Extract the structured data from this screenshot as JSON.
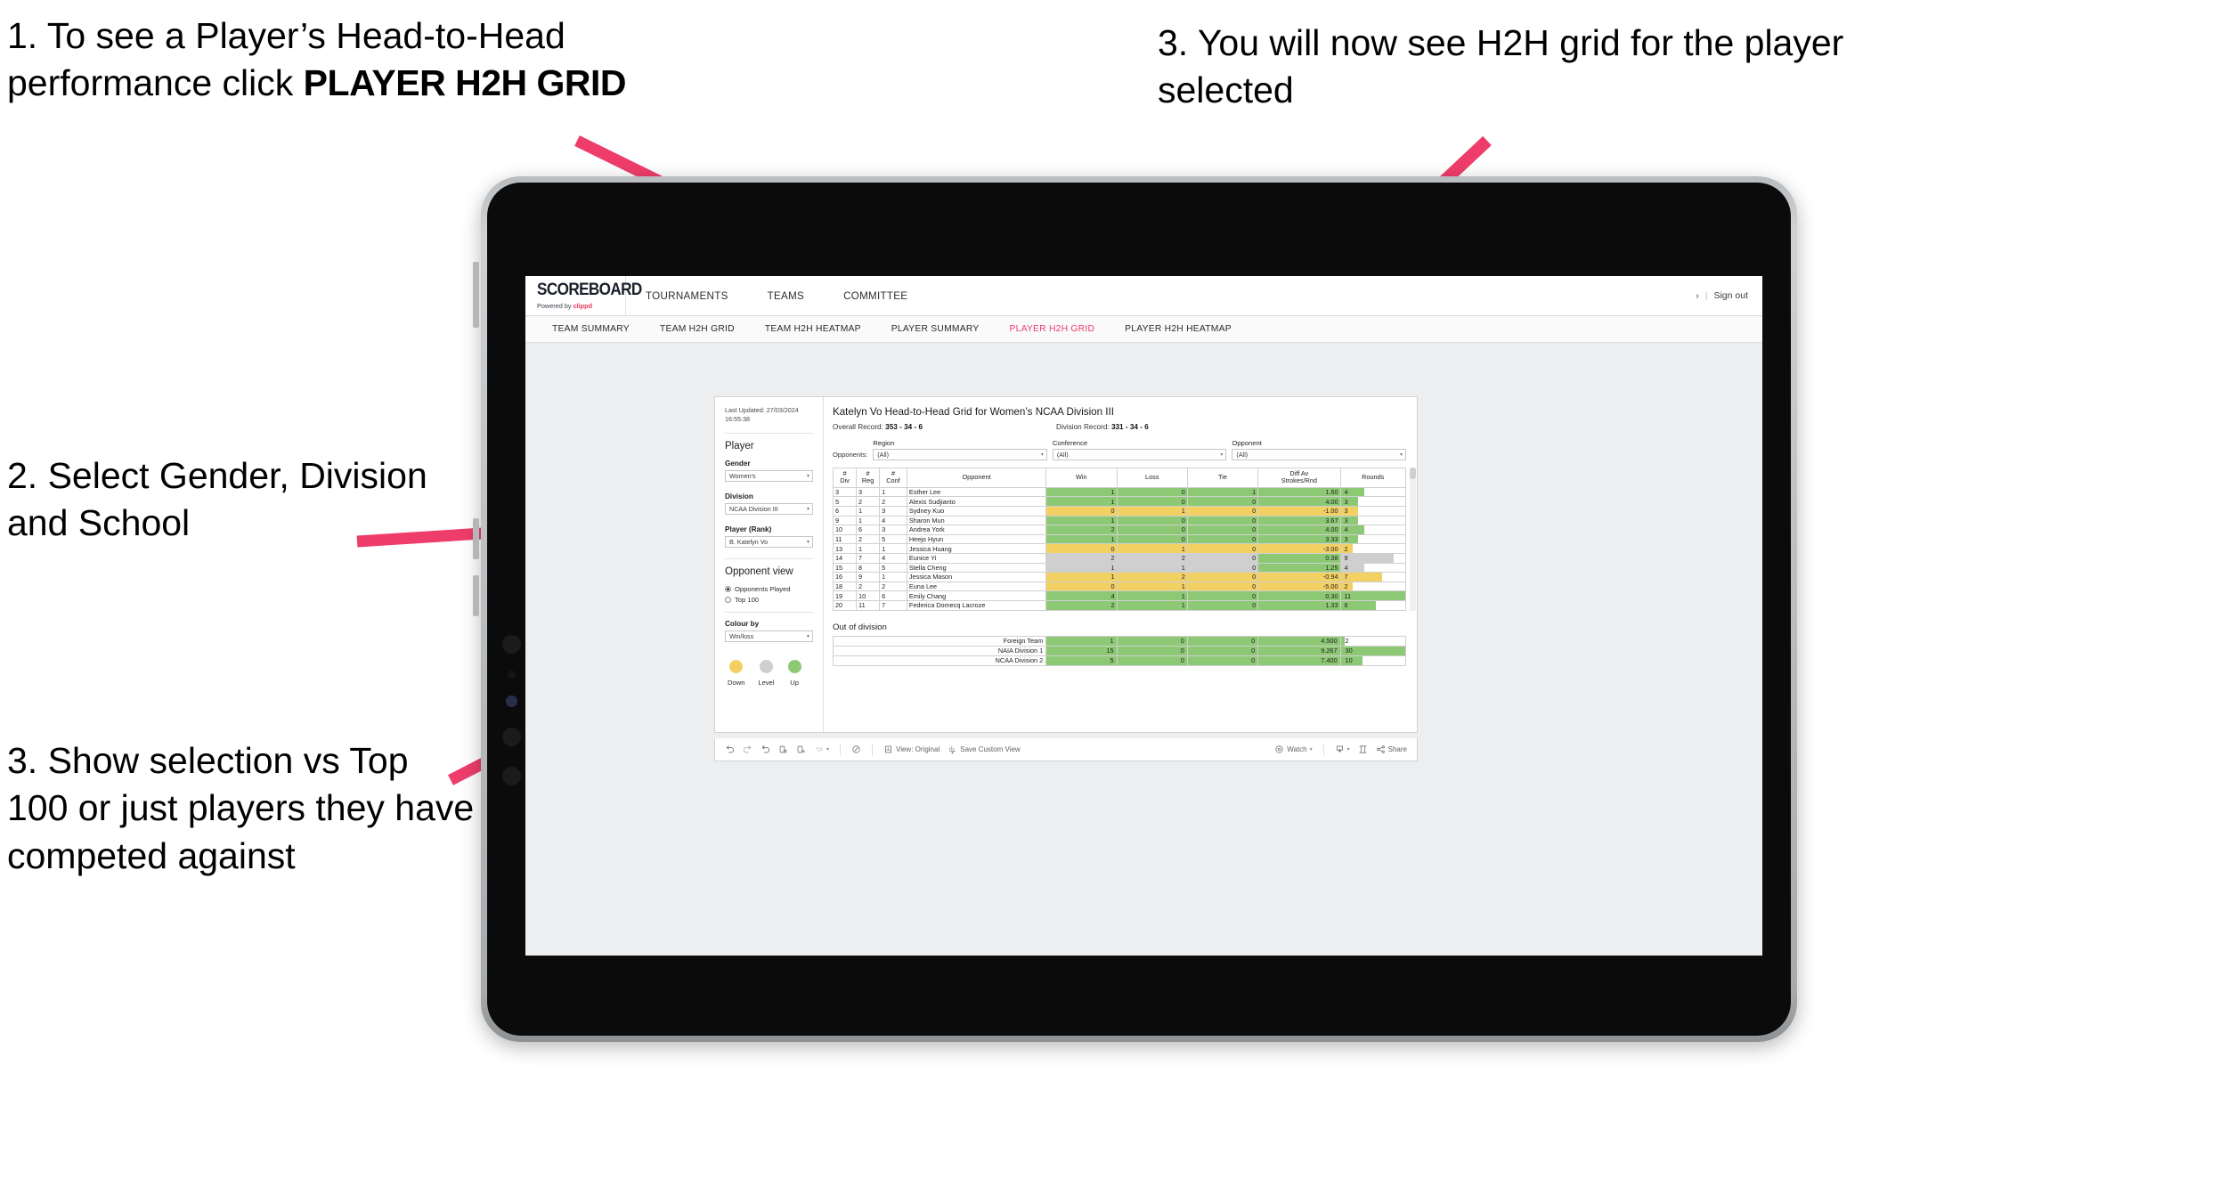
{
  "annotations": {
    "step1_a": "1. To see a Player’s Head-to-Head performance click ",
    "step1_b": "PLAYER H2H GRID",
    "step2": "2. Select Gender, Division and School",
    "step3_left": "3. Show selection vs Top 100 or just players they have competed against",
    "step3_right": "3. You will now see H2H grid for the player selected"
  },
  "colors": {
    "accent": "#ee3d6b",
    "brand": "#e8395c",
    "win": "#8dc974",
    "loss": "#f3d062",
    "level": "#cfcfcf"
  },
  "app": {
    "logo": {
      "main": "SCOREBOARD",
      "powered_prefix": "Powered by ",
      "brand": "clippd"
    },
    "topnav": [
      "TOURNAMENTS",
      "TEAMS",
      "COMMITTEE"
    ],
    "topright": {
      "chevron": "›",
      "separator": "|",
      "signout": "Sign out"
    },
    "subnav": [
      {
        "label": "TEAM SUMMARY",
        "active": false
      },
      {
        "label": "TEAM H2H GRID",
        "active": false
      },
      {
        "label": "TEAM H2H HEATMAP",
        "active": false
      },
      {
        "label": "PLAYER SUMMARY",
        "active": false
      },
      {
        "label": "PLAYER H2H GRID",
        "active": true
      },
      {
        "label": "PLAYER H2H HEATMAP",
        "active": false
      }
    ]
  },
  "filters": {
    "last_updated": "Last Updated: 27/03/2024 16:55:38",
    "player_heading": "Player",
    "gender": {
      "label": "Gender",
      "value": "Women's"
    },
    "division": {
      "label": "Division",
      "value": "NCAA Division III"
    },
    "player_rank": {
      "label": "Player (Rank)",
      "value": "B. Katelyn Vo"
    },
    "opponent_view": {
      "heading": "Opponent view",
      "options": [
        {
          "label": "Opponents Played",
          "selected": true
        },
        {
          "label": "Top 100",
          "selected": false
        }
      ]
    },
    "colour_by": {
      "label": "Colour by",
      "value": "Win/loss"
    },
    "legend": [
      {
        "label": "Down",
        "color": "#f3d062"
      },
      {
        "label": "Level",
        "color": "#cfcfcf"
      },
      {
        "label": "Up",
        "color": "#8dc974"
      }
    ]
  },
  "viz": {
    "title": "Katelyn Vo Head-to-Head Grid for Women’s NCAA Division III",
    "overall_record_label": "Overall Record:",
    "overall_record_value": "353 - 34 - 6",
    "division_record_label": "Division Record:",
    "division_record_value": "331 - 34 - 6",
    "opponents_label": "Opponents:",
    "opponent_filters": [
      {
        "label": "Region",
        "value": "(All)"
      },
      {
        "label": "Conference",
        "value": "(All)"
      },
      {
        "label": "Opponent",
        "value": "(All)"
      }
    ]
  },
  "chart_data": {
    "type": "table",
    "title": "Katelyn Vo Head-to-Head Grid for Women’s NCAA Division III",
    "columns": [
      "# Div",
      "# Reg",
      "# Conf",
      "Opponent",
      "Win",
      "Loss",
      "Tie",
      "Diff Av Strokes/Rnd",
      "Rounds"
    ],
    "rows": [
      {
        "div": "3",
        "reg": "3",
        "conf": "1",
        "opponent": "Esther Lee",
        "win": "1",
        "loss": "0",
        "tie": "1",
        "diff": "1.50",
        "rounds": "4",
        "status": "win"
      },
      {
        "div": "5",
        "reg": "2",
        "conf": "2",
        "opponent": "Alexis Sudjianto",
        "win": "1",
        "loss": "0",
        "tie": "0",
        "diff": "4.00",
        "rounds": "3",
        "status": "win"
      },
      {
        "div": "6",
        "reg": "1",
        "conf": "3",
        "opponent": "Sydney Kuo",
        "win": "0",
        "loss": "1",
        "tie": "0",
        "diff": "-1.00",
        "rounds": "3",
        "status": "loss"
      },
      {
        "div": "9",
        "reg": "1",
        "conf": "4",
        "opponent": "Sharon Mun",
        "win": "1",
        "loss": "0",
        "tie": "0",
        "diff": "3.67",
        "rounds": "3",
        "status": "win"
      },
      {
        "div": "10",
        "reg": "6",
        "conf": "3",
        "opponent": "Andrea York",
        "win": "2",
        "loss": "0",
        "tie": "0",
        "diff": "4.00",
        "rounds": "4",
        "status": "win"
      },
      {
        "div": "11",
        "reg": "2",
        "conf": "5",
        "opponent": "Heejo Hyun",
        "win": "1",
        "loss": "0",
        "tie": "0",
        "diff": "3.33",
        "rounds": "3",
        "status": "win"
      },
      {
        "div": "13",
        "reg": "1",
        "conf": "1",
        "opponent": "Jessica Huang",
        "win": "0",
        "loss": "1",
        "tie": "0",
        "diff": "-3.00",
        "rounds": "2",
        "status": "loss"
      },
      {
        "div": "14",
        "reg": "7",
        "conf": "4",
        "opponent": "Eunice Yi",
        "win": "2",
        "loss": "2",
        "tie": "0",
        "diff": "0.38",
        "rounds": "9",
        "status": "level"
      },
      {
        "div": "15",
        "reg": "8",
        "conf": "5",
        "opponent": "Stella Cheng",
        "win": "1",
        "loss": "1",
        "tie": "0",
        "diff": "1.25",
        "rounds": "4",
        "status": "level"
      },
      {
        "div": "16",
        "reg": "9",
        "conf": "1",
        "opponent": "Jessica Mason",
        "win": "1",
        "loss": "2",
        "tie": "0",
        "diff": "-0.94",
        "rounds": "7",
        "status": "loss"
      },
      {
        "div": "18",
        "reg": "2",
        "conf": "2",
        "opponent": "Euna Lee",
        "win": "0",
        "loss": "1",
        "tie": "0",
        "diff": "-5.00",
        "rounds": "2",
        "status": "loss"
      },
      {
        "div": "19",
        "reg": "10",
        "conf": "6",
        "opponent": "Emily Chang",
        "win": "4",
        "loss": "1",
        "tie": "0",
        "diff": "0.30",
        "rounds": "11",
        "status": "win"
      },
      {
        "div": "20",
        "reg": "11",
        "conf": "7",
        "opponent": "Federica Domecq Lacroze",
        "win": "2",
        "loss": "1",
        "tie": "0",
        "diff": "1.33",
        "rounds": "6",
        "status": "win"
      }
    ],
    "out_of_division": {
      "title": "Out of division",
      "rows": [
        {
          "name": "Foreign Team",
          "win": "1",
          "loss": "0",
          "tie": "0",
          "diff": "4.500",
          "rounds": "2",
          "status": "win"
        },
        {
          "name": "NAIA Division 1",
          "win": "15",
          "loss": "0",
          "tie": "0",
          "diff": "9.267",
          "rounds": "30",
          "status": "win"
        },
        {
          "name": "NCAA Division 2",
          "win": "5",
          "loss": "0",
          "tie": "0",
          "diff": "7.400",
          "rounds": "10",
          "status": "win"
        }
      ]
    }
  },
  "toolbar": {
    "view_original": "View: Original",
    "save_custom_view": "Save Custom View",
    "watch": "Watch",
    "share": "Share"
  }
}
